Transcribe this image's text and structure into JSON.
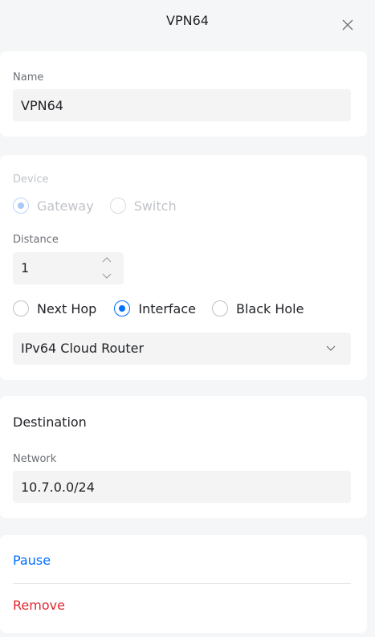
{
  "header": {
    "title": "VPN64"
  },
  "name_section": {
    "label": "Name",
    "value": "VPN64"
  },
  "route_section": {
    "device_label": "Device",
    "device_options": [
      {
        "label": "Gateway",
        "selected": true
      },
      {
        "label": "Switch",
        "selected": false
      }
    ],
    "distance_label": "Distance",
    "distance_value": "1",
    "type_options": [
      {
        "label": "Next Hop",
        "selected": false
      },
      {
        "label": "Interface",
        "selected": true
      },
      {
        "label": "Black Hole",
        "selected": false
      }
    ],
    "interface_value": "IPv64 Cloud Router"
  },
  "destination_section": {
    "title": "Destination",
    "network_label": "Network",
    "network_value": "10.7.0.0/24"
  },
  "actions": {
    "pause_label": "Pause",
    "remove_label": "Remove"
  },
  "colors": {
    "accent": "#006fff",
    "danger": "#e0272e",
    "background": "#f5f6f7"
  }
}
